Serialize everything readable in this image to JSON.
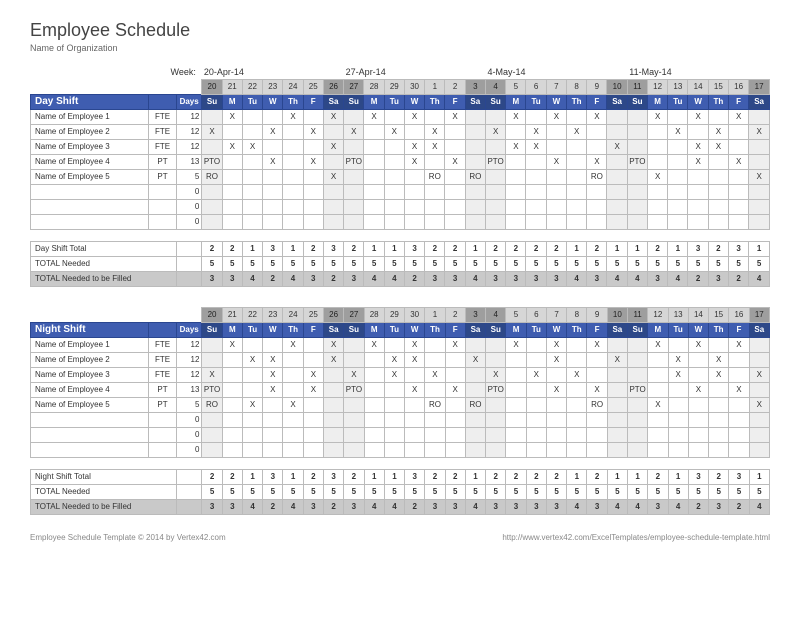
{
  "title": "Employee Schedule",
  "subtitle": "Name of Organization",
  "week_label": "Week:",
  "weeks": [
    "20-Apr-14",
    "27-Apr-14",
    "4-May-14",
    "11-May-14"
  ],
  "day_numbers": [
    "20",
    "21",
    "22",
    "23",
    "24",
    "25",
    "26",
    "27",
    "28",
    "29",
    "30",
    "1",
    "2",
    "3",
    "4",
    "5",
    "6",
    "7",
    "8",
    "9",
    "10",
    "11",
    "12",
    "13",
    "14",
    "15",
    "16",
    "17"
  ],
  "dow": [
    "Su",
    "M",
    "Tu",
    "W",
    "Th",
    "F",
    "Sa",
    "Su",
    "M",
    "Tu",
    "W",
    "Th",
    "F",
    "Sa",
    "Su",
    "M",
    "Tu",
    "W",
    "Th",
    "F",
    "Sa",
    "Su",
    "M",
    "Tu",
    "W",
    "Th",
    "F",
    "Sa"
  ],
  "weekend_idx": [
    0,
    6,
    7,
    13,
    14,
    20,
    21,
    27
  ],
  "shifts": [
    {
      "name": "Day Shift",
      "days_header": "Days",
      "employees": [
        {
          "name": "Name of Employee 1",
          "type": "FTE",
          "days": "12",
          "marks": [
            "",
            "X",
            "",
            "",
            "X",
            "",
            "X",
            "",
            "X",
            "",
            "X",
            "",
            "X",
            "",
            "",
            "X",
            "",
            "X",
            "",
            "X",
            "",
            "",
            "X",
            "",
            "X",
            "",
            "X",
            ""
          ]
        },
        {
          "name": "Name of Employee 2",
          "type": "FTE",
          "days": "12",
          "marks": [
            "X",
            "",
            "",
            "X",
            "",
            "X",
            "",
            "X",
            "",
            "X",
            "",
            "X",
            "",
            "",
            "X",
            "",
            "X",
            "",
            "X",
            "",
            "",
            "",
            "",
            "X",
            "",
            "X",
            "",
            "X"
          ]
        },
        {
          "name": "Name of Employee 3",
          "type": "FTE",
          "days": "12",
          "marks": [
            "",
            "X",
            "X",
            "",
            "",
            "",
            "X",
            "",
            "",
            "",
            "X",
            "X",
            "",
            "",
            "",
            "X",
            "X",
            "",
            "",
            "",
            "X",
            "",
            "",
            "",
            "X",
            "X",
            "",
            ""
          ]
        },
        {
          "name": "Name of Employee 4",
          "type": "PT",
          "days": "13",
          "marks": [
            "PTO",
            "",
            "",
            "X",
            "",
            "X",
            "",
            "PTO",
            "",
            "",
            "X",
            "",
            "X",
            "",
            "PTO",
            "",
            "",
            "X",
            "",
            "X",
            "",
            "PTO",
            "",
            "",
            "X",
            "",
            "X",
            ""
          ]
        },
        {
          "name": "Name of Employee 5",
          "type": "PT",
          "days": "5",
          "marks": [
            "RO",
            "",
            "",
            "",
            "",
            "",
            "X",
            "",
            "",
            "",
            "",
            "RO",
            "",
            "RO",
            "",
            "",
            "",
            "",
            "",
            "RO",
            "",
            "",
            "X",
            "",
            "",
            "",
            "",
            "X"
          ]
        },
        {
          "name": "",
          "type": "",
          "days": "0",
          "marks": [
            "",
            "",
            "",
            "",
            "",
            "",
            "",
            "",
            "",
            "",
            "",
            "",
            "",
            "",
            "",
            "",
            "",
            "",
            "",
            "",
            "",
            "",
            "",
            "",
            "",
            "",
            "",
            ""
          ]
        },
        {
          "name": "",
          "type": "",
          "days": "0",
          "marks": [
            "",
            "",
            "",
            "",
            "",
            "",
            "",
            "",
            "",
            "",
            "",
            "",
            "",
            "",
            "",
            "",
            "",
            "",
            "",
            "",
            "",
            "",
            "",
            "",
            "",
            "",
            "",
            ""
          ]
        },
        {
          "name": "",
          "type": "",
          "days": "0",
          "marks": [
            "",
            "",
            "",
            "",
            "",
            "",
            "",
            "",
            "",
            "",
            "",
            "",
            "",
            "",
            "",
            "",
            "",
            "",
            "",
            "",
            "",
            "",
            "",
            "",
            "",
            "",
            "",
            ""
          ]
        }
      ],
      "totals": [
        {
          "label": "Day Shift Total",
          "vals": [
            "2",
            "2",
            "1",
            "3",
            "1",
            "2",
            "3",
            "2",
            "1",
            "1",
            "3",
            "2",
            "2",
            "1",
            "2",
            "2",
            "2",
            "2",
            "1",
            "2",
            "1",
            "1",
            "2",
            "1",
            "3",
            "2",
            "3",
            "1"
          ]
        },
        {
          "label": "TOTAL Needed",
          "vals": [
            "5",
            "5",
            "5",
            "5",
            "5",
            "5",
            "5",
            "5",
            "5",
            "5",
            "5",
            "5",
            "5",
            "5",
            "5",
            "5",
            "5",
            "5",
            "5",
            "5",
            "5",
            "5",
            "5",
            "5",
            "5",
            "5",
            "5",
            "5"
          ]
        },
        {
          "label": "TOTAL Needed to be Filled",
          "fill": true,
          "vals": [
            "3",
            "3",
            "4",
            "2",
            "4",
            "3",
            "2",
            "3",
            "4",
            "4",
            "2",
            "3",
            "3",
            "4",
            "3",
            "3",
            "3",
            "3",
            "4",
            "3",
            "4",
            "4",
            "3",
            "4",
            "2",
            "3",
            "2",
            "4"
          ]
        }
      ]
    },
    {
      "name": "Night Shift",
      "days_header": "Days",
      "employees": [
        {
          "name": "Name of Employee 1",
          "type": "FTE",
          "days": "12",
          "marks": [
            "",
            "X",
            "",
            "",
            "X",
            "",
            "X",
            "",
            "X",
            "",
            "X",
            "",
            "X",
            "",
            "",
            "X",
            "",
            "X",
            "",
            "X",
            "",
            "",
            "X",
            "",
            "X",
            "",
            "X",
            ""
          ]
        },
        {
          "name": "Name of Employee 2",
          "type": "FTE",
          "days": "12",
          "marks": [
            "",
            "",
            "X",
            "X",
            "",
            "",
            "X",
            "",
            "",
            "X",
            "X",
            "",
            "",
            "X",
            "",
            "",
            "",
            "X",
            "",
            "",
            "X",
            "",
            "",
            "X",
            "",
            "X",
            "",
            ""
          ]
        },
        {
          "name": "Name of Employee 3",
          "type": "FTE",
          "days": "12",
          "marks": [
            "X",
            "",
            "",
            "X",
            "",
            "X",
            "",
            "X",
            "",
            "X",
            "",
            "X",
            "",
            "",
            "X",
            "",
            "X",
            "",
            "X",
            "",
            "",
            "",
            "",
            "X",
            "",
            "X",
            "",
            "X"
          ]
        },
        {
          "name": "Name of Employee 4",
          "type": "PT",
          "days": "13",
          "marks": [
            "PTO",
            "",
            "",
            "X",
            "",
            "X",
            "",
            "PTO",
            "",
            "",
            "X",
            "",
            "X",
            "",
            "PTO",
            "",
            "",
            "X",
            "",
            "X",
            "",
            "PTO",
            "",
            "",
            "X",
            "",
            "X",
            ""
          ]
        },
        {
          "name": "Name of Employee 5",
          "type": "PT",
          "days": "5",
          "marks": [
            "RO",
            "",
            "X",
            "",
            "X",
            "",
            "",
            "",
            "",
            "",
            "",
            "RO",
            "",
            "RO",
            "",
            "",
            "",
            "",
            "",
            "RO",
            "",
            "",
            "X",
            "",
            "",
            "",
            "",
            "X"
          ]
        },
        {
          "name": "",
          "type": "",
          "days": "0",
          "marks": [
            "",
            "",
            "",
            "",
            "",
            "",
            "",
            "",
            "",
            "",
            "",
            "",
            "",
            "",
            "",
            "",
            "",
            "",
            "",
            "",
            "",
            "",
            "",
            "",
            "",
            "",
            "",
            ""
          ]
        },
        {
          "name": "",
          "type": "",
          "days": "0",
          "marks": [
            "",
            "",
            "",
            "",
            "",
            "",
            "",
            "",
            "",
            "",
            "",
            "",
            "",
            "",
            "",
            "",
            "",
            "",
            "",
            "",
            "",
            "",
            "",
            "",
            "",
            "",
            "",
            ""
          ]
        },
        {
          "name": "",
          "type": "",
          "days": "0",
          "marks": [
            "",
            "",
            "",
            "",
            "",
            "",
            "",
            "",
            "",
            "",
            "",
            "",
            "",
            "",
            "",
            "",
            "",
            "",
            "",
            "",
            "",
            "",
            "",
            "",
            "",
            "",
            "",
            ""
          ]
        }
      ],
      "totals": [
        {
          "label": "Night Shift Total",
          "vals": [
            "2",
            "2",
            "1",
            "3",
            "1",
            "2",
            "3",
            "2",
            "1",
            "1",
            "3",
            "2",
            "2",
            "1",
            "2",
            "2",
            "2",
            "2",
            "1",
            "2",
            "1",
            "1",
            "2",
            "1",
            "3",
            "2",
            "3",
            "1"
          ]
        },
        {
          "label": "TOTAL Needed",
          "vals": [
            "5",
            "5",
            "5",
            "5",
            "5",
            "5",
            "5",
            "5",
            "5",
            "5",
            "5",
            "5",
            "5",
            "5",
            "5",
            "5",
            "5",
            "5",
            "5",
            "5",
            "5",
            "5",
            "5",
            "5",
            "5",
            "5",
            "5",
            "5"
          ]
        },
        {
          "label": "TOTAL Needed to be Filled",
          "fill": true,
          "vals": [
            "3",
            "3",
            "4",
            "2",
            "4",
            "3",
            "2",
            "3",
            "4",
            "4",
            "2",
            "3",
            "3",
            "4",
            "3",
            "3",
            "3",
            "3",
            "4",
            "3",
            "4",
            "4",
            "3",
            "4",
            "2",
            "3",
            "2",
            "4"
          ]
        }
      ]
    }
  ],
  "footer_left": "Employee Schedule Template © 2014 by Vertex42.com",
  "footer_right": "http://www.vertex42.com/ExcelTemplates/employee-schedule-template.html"
}
